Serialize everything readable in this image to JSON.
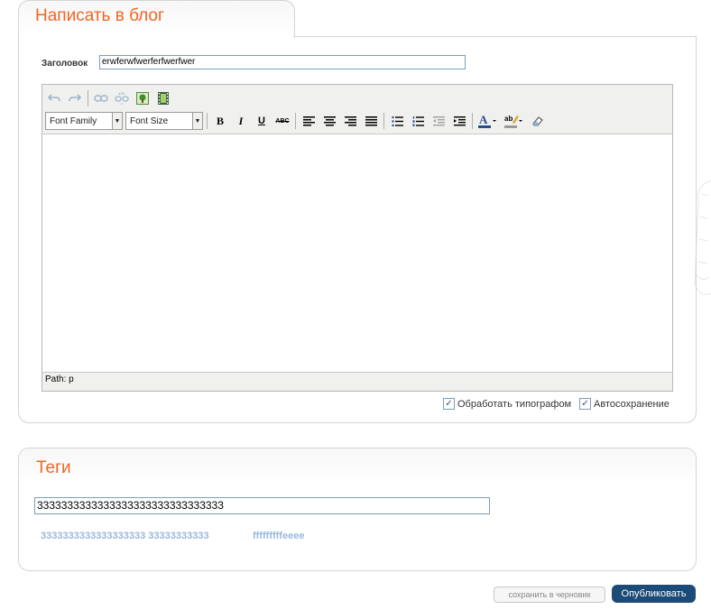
{
  "write_panel": {
    "title": "Написать в блог",
    "title_label": "Заголовок",
    "title_value": "erwferwfwerferfwerfwer"
  },
  "editor": {
    "font_family_label": "Font Family",
    "font_size_label": "Font Size",
    "bold_label": "B",
    "italic_label": "I",
    "underline_label": "U",
    "strike_label": "ABC",
    "path_text": "Path: p",
    "icons": [
      "undo-icon",
      "redo-icon",
      "link-icon",
      "unlink-icon",
      "insert-image-icon",
      "insert-video-icon",
      "align-left-icon",
      "align-center-icon",
      "align-right-icon",
      "align-justify-icon",
      "bullet-list-icon",
      "numbered-list-icon",
      "outdent-icon",
      "indent-icon",
      "text-color-icon",
      "highlight-color-icon",
      "clear-format-icon"
    ]
  },
  "options": {
    "typograph_label": "Обработать типографом",
    "typograph_checked": true,
    "autosave_label": "Автосохранение",
    "autosave_checked": true
  },
  "tags_panel": {
    "title": "Теги",
    "tags_value": "3333333333333333333333333333333",
    "suggestions": [
      "3333333333333333333 33333333333",
      "fffffffffeeee"
    ]
  },
  "actions": {
    "draft_label": "сохранить в черновик",
    "publish_label": "Опубликовать"
  },
  "colors": {
    "accent": "#f26522",
    "publish_bg": "#1d4b78",
    "suggestion": "#9ab8dc",
    "toolbar_bg": "#f0f0ee"
  }
}
